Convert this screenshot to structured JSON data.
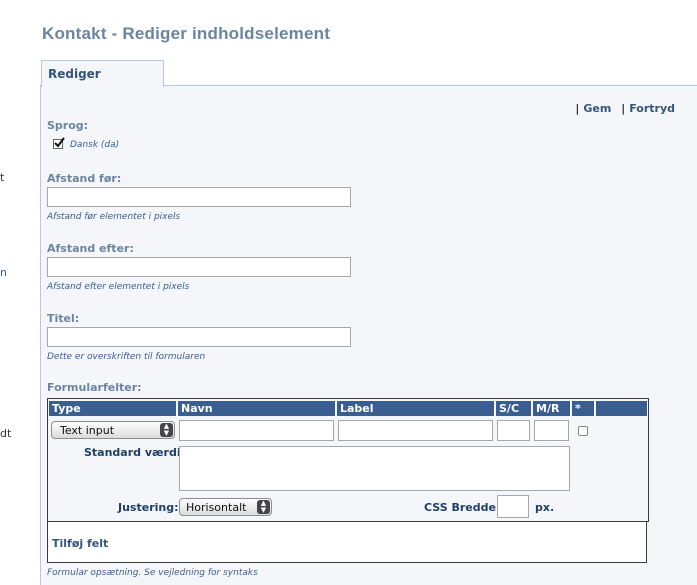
{
  "page": {
    "title": "Kontakt - Rediger indholdselement",
    "tab_label": "Rediger",
    "edge_fragments": [
      "t",
      "n",
      "dt"
    ]
  },
  "actions": {
    "save": "Gem",
    "cancel": "Fortryd",
    "separator": "|"
  },
  "fields": {
    "language": {
      "label": "Sprog:",
      "option": "Dansk (da)",
      "checked": true
    },
    "space_before": {
      "label": "Afstand før:",
      "value": "",
      "help": "Afstand før elementet i pixels"
    },
    "space_after": {
      "label": "Afstand efter:",
      "value": "",
      "help": "Afstand efter elementet i pixels"
    },
    "title": {
      "label": "Titel:",
      "value": "",
      "help": "Dette er overskriften til formularen"
    }
  },
  "form_fields": {
    "label": "Formularfelter:",
    "columns": [
      "Type",
      "Navn",
      "Label",
      "S/C",
      "M/R",
      "*"
    ],
    "row": {
      "type_value": "Text input",
      "default_label": "Standard værdi:",
      "align_label": "Justering:",
      "align_value": "Horisontalt",
      "css_width_label": "CSS Bredde:",
      "css_width_unit": "px.",
      "required_checked": false
    },
    "add_field": "Tilføj felt",
    "help": "Formular opsætning. Se vejledning for syntaks"
  },
  "colors": {
    "header_bg": "#3a5e90",
    "panel_bg": "#f4f6fa",
    "title_color": "#6b85a1",
    "link_color": "#34557a"
  }
}
